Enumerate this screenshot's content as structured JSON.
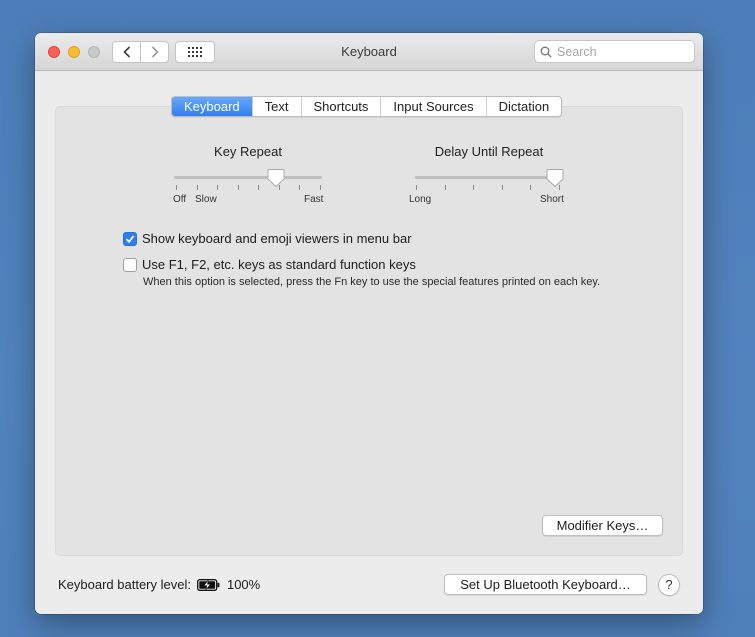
{
  "window": {
    "title": "Keyboard"
  },
  "toolbar": {
    "search_placeholder": "Search",
    "back_icon": "chevron-left-icon",
    "forward_icon": "chevron-right-icon",
    "grid_icon": "grid-icon"
  },
  "tabs": [
    {
      "label": "Keyboard",
      "active": true
    },
    {
      "label": "Text",
      "active": false
    },
    {
      "label": "Shortcuts",
      "active": false
    },
    {
      "label": "Input Sources",
      "active": false
    },
    {
      "label": "Dictation",
      "active": false
    }
  ],
  "key_repeat": {
    "label": "Key Repeat",
    "min_label": "Off",
    "slow_label": "Slow",
    "max_label": "Fast",
    "ticks": 8,
    "value_index": 6
  },
  "delay_until_repeat": {
    "label": "Delay Until Repeat",
    "min_label": "Long",
    "max_label": "Short",
    "ticks": 6,
    "value_index": 5
  },
  "options": {
    "show_viewers": {
      "label": "Show keyboard and emoji viewers in menu bar",
      "checked": true
    },
    "fn_keys": {
      "label": "Use F1, F2, etc. keys as standard function keys",
      "checked": false,
      "hint": "When this option is selected, press the Fn key to use the special features printed on each key."
    }
  },
  "buttons": {
    "modifier_keys": "Modifier Keys…",
    "bluetooth": "Set Up Bluetooth Keyboard…",
    "help": "?"
  },
  "battery": {
    "label": "Keyboard battery level:",
    "value": "100%",
    "icon": "battery-charging-icon"
  },
  "colors": {
    "accent": "#2f7ff1",
    "desktop": "#4f7fb8"
  }
}
